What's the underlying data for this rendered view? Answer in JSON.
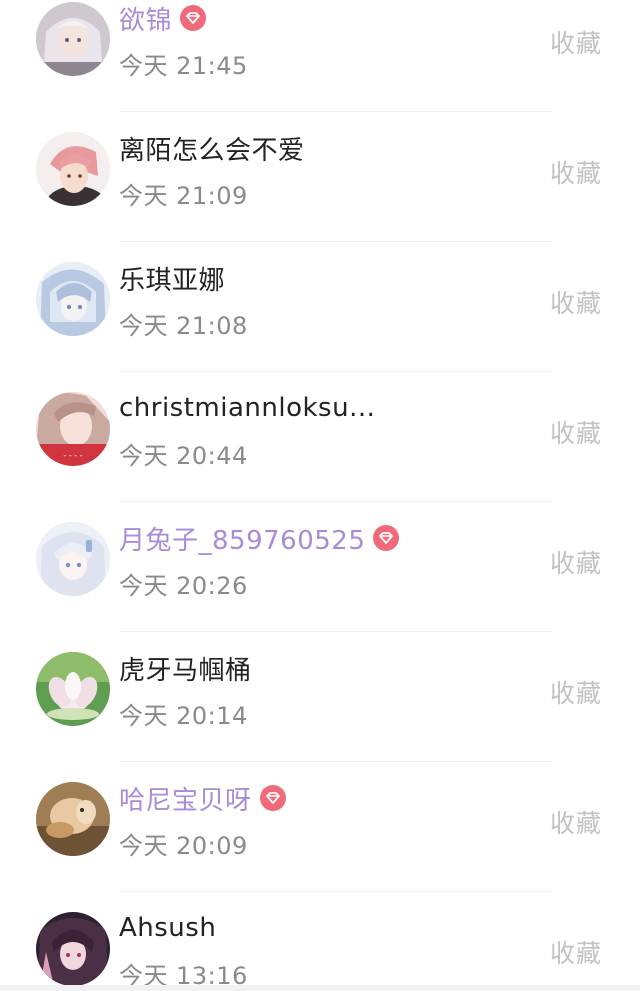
{
  "list": {
    "items": [
      {
        "name": "欲锦",
        "vip": true,
        "time": "今天 21:45",
        "action": "收藏",
        "avatar": "avatar-girl-silver-hair"
      },
      {
        "name": "离陌怎么会不爱",
        "vip": false,
        "time": "今天 21:09",
        "action": "收藏",
        "avatar": "avatar-boy-pink-hair"
      },
      {
        "name": "乐琪亚娜",
        "vip": false,
        "time": "今天 21:08",
        "action": "收藏",
        "avatar": "avatar-blue-anime-girl"
      },
      {
        "name": "christmiannloksu...",
        "vip": false,
        "time": "今天 20:44",
        "action": "收藏",
        "avatar": "avatar-woman-photo"
      },
      {
        "name": "月兔子_859760525",
        "vip": true,
        "time": "今天 20:26",
        "action": "收藏",
        "avatar": "avatar-white-hair-girl"
      },
      {
        "name": "虎牙马帼桶",
        "vip": false,
        "time": "今天 20:14",
        "action": "收藏",
        "avatar": "avatar-lotus-flower"
      },
      {
        "name": "哈尼宝贝呀",
        "vip": true,
        "time": "今天 20:09",
        "action": "收藏",
        "avatar": "avatar-pet-photo"
      },
      {
        "name": "Ahsush",
        "vip": false,
        "time": "今天 13:16",
        "action": "收藏",
        "avatar": "avatar-dark-anime-girl"
      }
    ]
  },
  "colors": {
    "vip_name": "#a98bd8",
    "vip_badge": "#f06a7a",
    "name": "#222222",
    "time": "#8a8a8a",
    "action": "#c2c2c2"
  },
  "icons": {
    "vip_badge": "diamond-badge-icon"
  }
}
